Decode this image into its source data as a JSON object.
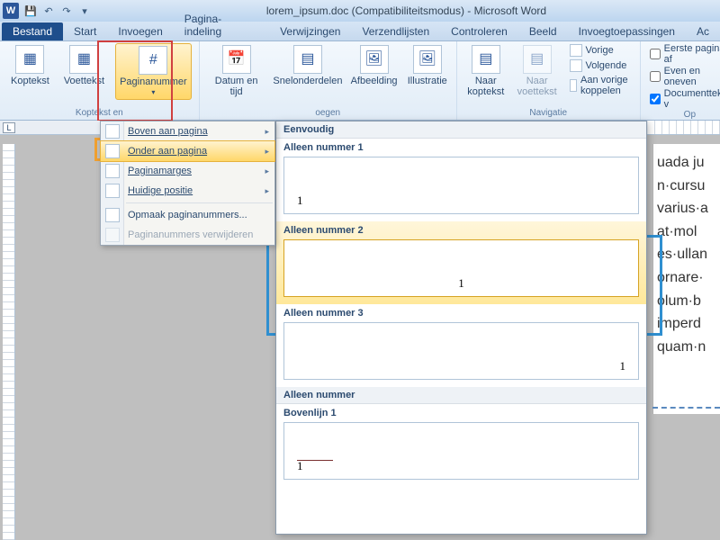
{
  "title": "lorem_ipsum.doc (Compatibiliteitsmodus) - Microsoft Word",
  "qat": {
    "save": "💾",
    "undo": "↶",
    "redo": "↷"
  },
  "tabs": {
    "file": "Bestand",
    "items": [
      "Start",
      "Invoegen",
      "Pagina-indeling",
      "Verwijzingen",
      "Verzendlijsten",
      "Controleren",
      "Beeld",
      "Invoegtoepassingen",
      "Ac"
    ]
  },
  "ribbon": {
    "header_footer": {
      "label": "Koptekst en",
      "koptekst": "Koptekst",
      "voettekst": "Voettekst",
      "paginanummer": "Paginanummer"
    },
    "insert": {
      "datum": "Datum en tijd",
      "snel": "Snelonderdelen",
      "afbeelding": "Afbeelding",
      "illustratie": "Illustratie",
      "label": "oegen"
    },
    "nav": {
      "naar_kop": "Naar koptekst",
      "naar_voet": "Naar voettekst",
      "vorige": "Vorige",
      "volgende": "Volgende",
      "koppelen": "Aan vorige koppelen",
      "label": "Navigatie"
    },
    "options": {
      "eerste": "Eerste pagina af",
      "even": "Even en oneven",
      "doctekst": "Documenttekst v",
      "label": "Op"
    }
  },
  "menu": {
    "items": [
      {
        "label": "Boven aan pagina",
        "sub": true
      },
      {
        "label": "Onder aan pagina",
        "sub": true,
        "hover": true
      },
      {
        "label": "Paginamarges",
        "sub": true
      },
      {
        "label": "Huidige positie",
        "sub": true
      },
      {
        "sep": true
      },
      {
        "label": "Opmaak paginanummers..."
      },
      {
        "label": "Paginanummers verwijderen",
        "disabled": true
      }
    ]
  },
  "gallery": {
    "section1": "Eenvoudig",
    "items1": [
      {
        "caption": "Alleen nummer 1",
        "num": "1",
        "pos": "left"
      },
      {
        "caption": "Alleen nummer 2",
        "num": "1",
        "pos": "center",
        "hover": true
      },
      {
        "caption": "Alleen nummer 3",
        "num": "1",
        "pos": "right"
      }
    ],
    "section2": "Alleen nummer",
    "items2": [
      {
        "caption": "Bovenlijn 1",
        "num": "1",
        "pos": "left",
        "bar": true
      }
    ]
  },
  "doc_lines": [
    "uada ju",
    "n·cursu",
    "varius·a",
    "at·mol",
    "es·ullan",
    "ornare·",
    "olum·b",
    "imperd",
    "quam·n"
  ],
  "ruler_tab": "L"
}
